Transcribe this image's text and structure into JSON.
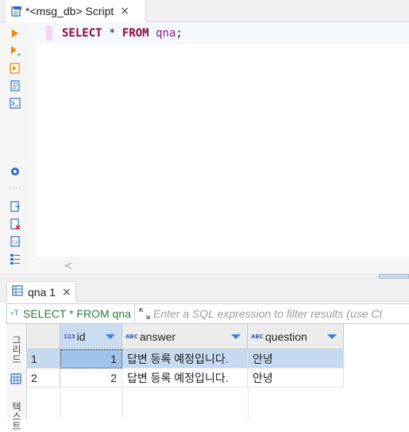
{
  "editor_tab": {
    "title": "*<msg_db> Script",
    "close": "×"
  },
  "sql": {
    "keyword_select": "SELECT",
    "star": "*",
    "keyword_from": "FROM",
    "table": "qna",
    "semicolon": ";"
  },
  "scroll": {
    "left_arrow": "<"
  },
  "results_tab": {
    "title": "qna 1",
    "close": "×"
  },
  "filter": {
    "query_text": "SELECT * FROM qna",
    "placeholder": "Enter a SQL expression to filter results (use Ct"
  },
  "side_panel_tabs": [
    "그리드",
    "텍스트"
  ],
  "grid": {
    "columns": [
      {
        "label": "id",
        "type_badge": "123"
      },
      {
        "label": "answer",
        "type_badge": "ABC"
      },
      {
        "label": "question",
        "type_badge": "ABC"
      }
    ],
    "rows": [
      {
        "num": "1",
        "id": "1",
        "answer": "답변 등록 예정입니다.",
        "question": "안녕"
      },
      {
        "num": "2",
        "id": "2",
        "answer": "답변 등록 예정입니다.",
        "question": "안녕"
      }
    ]
  },
  "colors": {
    "keyword": "#8b0a3e",
    "identifier": "#8b1a8b",
    "filter_query": "#2a7a3a",
    "selection": "#c5daf0",
    "accent": "#3b7fd4"
  }
}
